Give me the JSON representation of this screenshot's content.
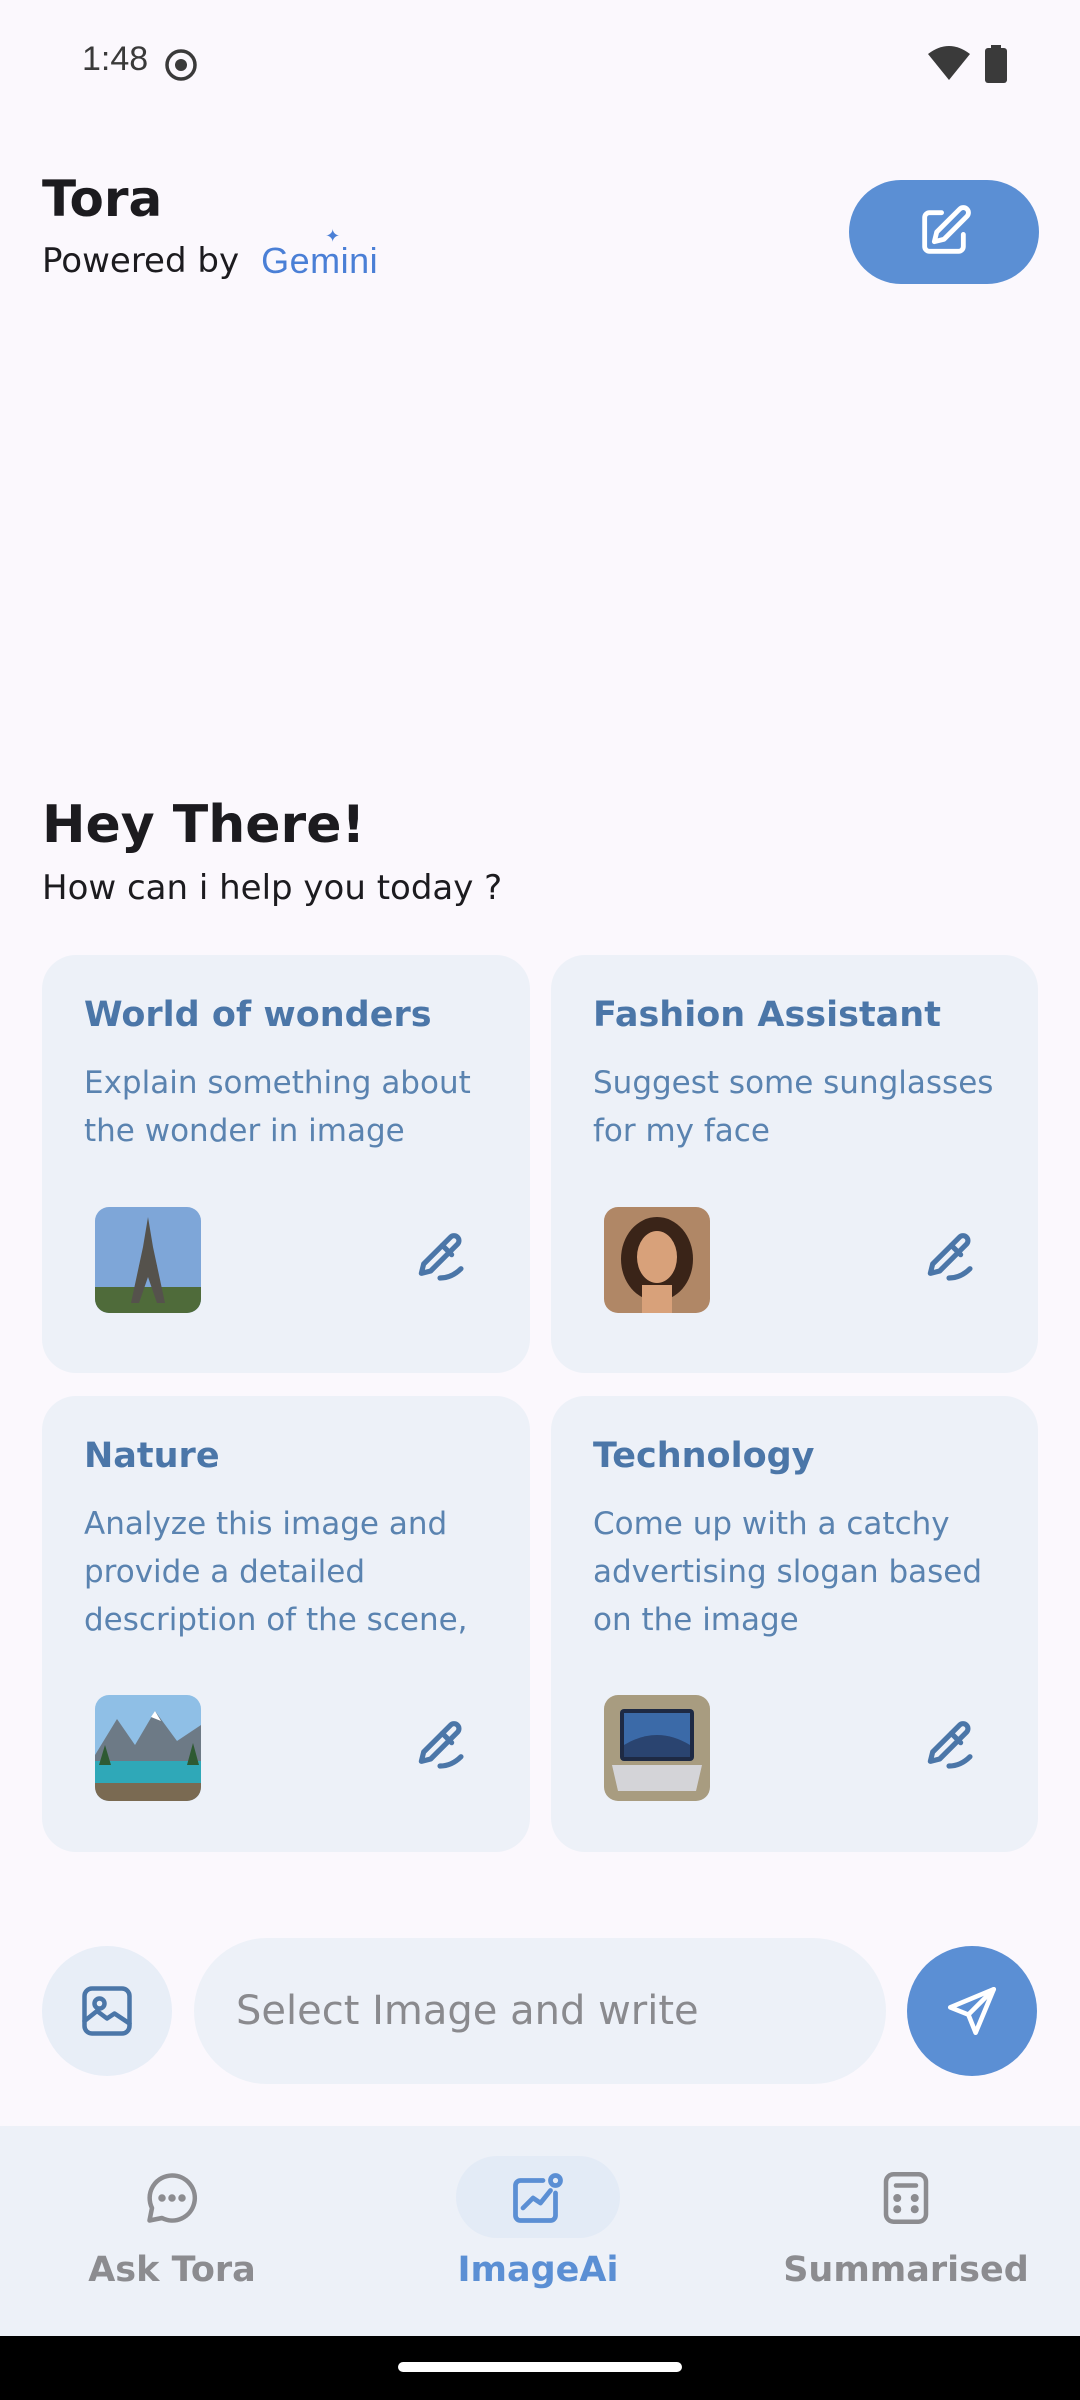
{
  "status_bar": {
    "time": "1:48",
    "icons": [
      "screen-record-icon",
      "wifi-icon",
      "battery-icon"
    ]
  },
  "header": {
    "app_title": "Tora",
    "powered_by": "Powered by",
    "brand": "Gemini",
    "new_chat_icon": "edit-icon"
  },
  "greeting": {
    "title": "Hey There!",
    "subtitle": "How can i help you today ?"
  },
  "cards": [
    {
      "title": "World of wonders",
      "description": "Explain something about the wonder in image",
      "thumbnail": "eiffel-tower-image"
    },
    {
      "title": "Fashion Assistant",
      "description": "Suggest some sunglasses for my face",
      "thumbnail": "portrait-image"
    },
    {
      "title": "Nature",
      "description": "Analyze this image and provide a detailed description of the scene,",
      "thumbnail": "mountain-lake-image"
    },
    {
      "title": "Technology",
      "description": "Come up with a catchy advertising slogan based on the image",
      "thumbnail": "laptop-image"
    }
  ],
  "composer": {
    "placeholder": "Select Image and write",
    "value": ""
  },
  "bottom_nav": {
    "items": [
      {
        "label": "Ask Tora",
        "icon": "chat-bubble-icon",
        "active": false
      },
      {
        "label": "ImageAi",
        "icon": "image-chart-icon",
        "active": true
      },
      {
        "label": "Summarised",
        "icon": "calculator-icon",
        "active": false
      }
    ]
  },
  "colors": {
    "accent": "#5b8fd4",
    "card_bg": "#edf1f8",
    "card_title": "#4b76a8",
    "background": "#fbf8fd"
  }
}
